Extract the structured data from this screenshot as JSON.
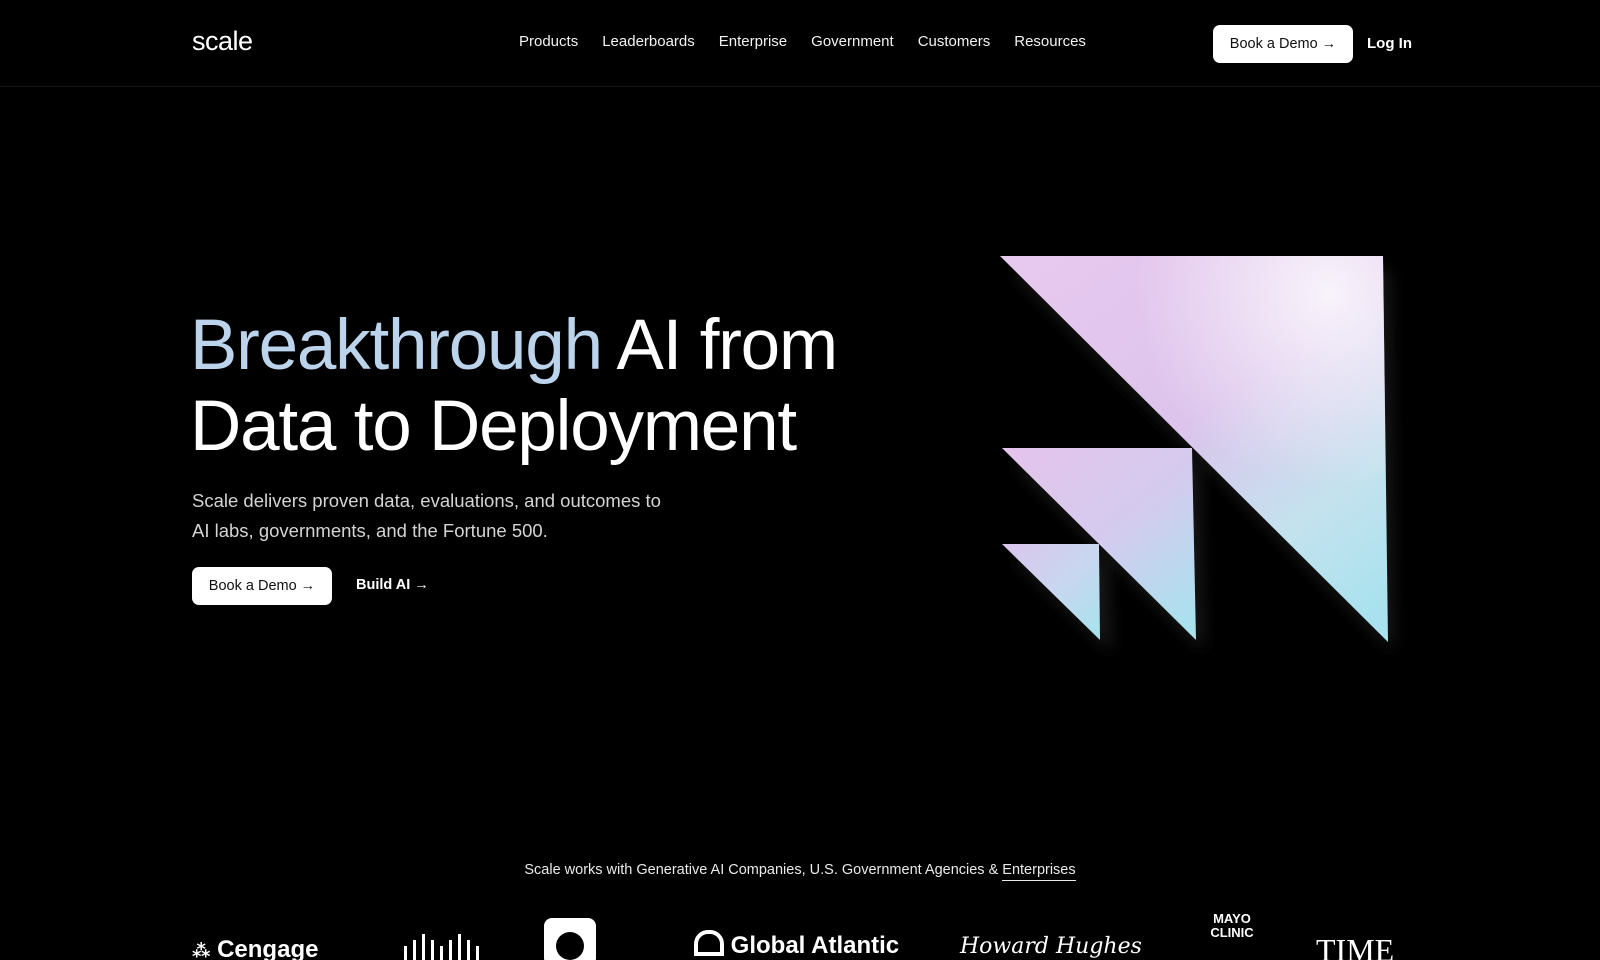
{
  "nav": {
    "logo": "scale",
    "links": [
      "Products",
      "Leaderboards",
      "Enterprise",
      "Government",
      "Customers",
      "Resources"
    ],
    "cta": "Book a Demo →",
    "login": "Log In"
  },
  "hero": {
    "title_highlight": "Breakthrough",
    "title_rest_1": " AI from",
    "title_line2": "Data to Deployment",
    "subtitle": "Scale delivers proven data, evaluations, and outcomes to AI labs, governments, and the Fortune 500.",
    "cta_primary": "Book a Demo →",
    "cta_secondary": "Build AI →"
  },
  "partners": {
    "text": "Scale works with Generative AI Companies, U.S. Government Agencies & ",
    "link": "Enterprises",
    "logos": [
      "Cengage",
      "Cisco",
      "Global Atlantic",
      "Howard Hughes",
      "MAYO CLINIC",
      "TIME"
    ]
  },
  "colors": {
    "background": "#000000",
    "highlight": "#bcd3ec",
    "art_pink": "#e3c4ec",
    "art_cyan": "#b6e6f0"
  }
}
